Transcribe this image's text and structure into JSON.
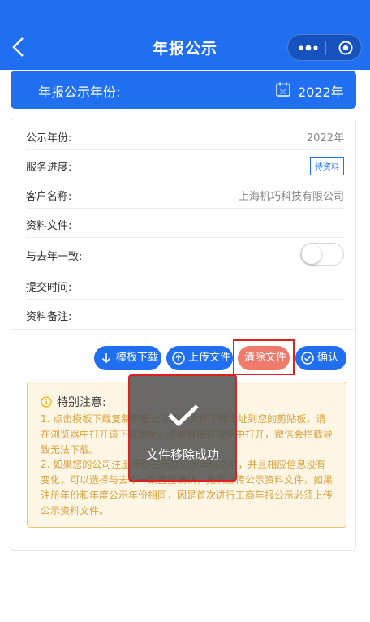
{
  "nav": {
    "title": "年报公示"
  },
  "banner": {
    "label": "年报公示年份:",
    "year": "2022年",
    "calendar_day": "30"
  },
  "rows": [
    {
      "key": "公示年份:",
      "value": "2022年"
    },
    {
      "key": "服务进度:",
      "value": "待资料"
    },
    {
      "key": "客户名称:",
      "value": "上海机巧科技有限公司"
    },
    {
      "key": "资料文件:",
      "value": ""
    },
    {
      "key": "与去年一致:",
      "value": ""
    },
    {
      "key": "提交时间:",
      "value": ""
    },
    {
      "key": "资料备注:",
      "value": ""
    }
  ],
  "toggle": {
    "on": false
  },
  "buttons": {
    "download": "模板下载",
    "upload": "上传文件",
    "clear": "清除文件",
    "confirm": "确认"
  },
  "notice": {
    "title": "特别注意:",
    "p1": "1. 点击模板下载复制年报公示模板文件下载地址到您的剪贴板，请在浏览器中打开该下载地址，不要直接在微信中打开，微信会拦截导致无法下载。",
    "p2": "2. 如果您的公司注册年份在年度公示年份之前，并且相应信息没有变化，可以选择与去年一致直接确认，无需上传公示资料文件，如果注册年份和年度公示年份相同，因是首次进行工商年报公示必须上传公示资料文件。"
  },
  "toast": {
    "message": "文件移除成功"
  },
  "colors": {
    "primary": "#1f6ff0",
    "danger": "#f07a6c",
    "notice_bg": "#fdf6e4",
    "notice_text": "#d9a343"
  }
}
